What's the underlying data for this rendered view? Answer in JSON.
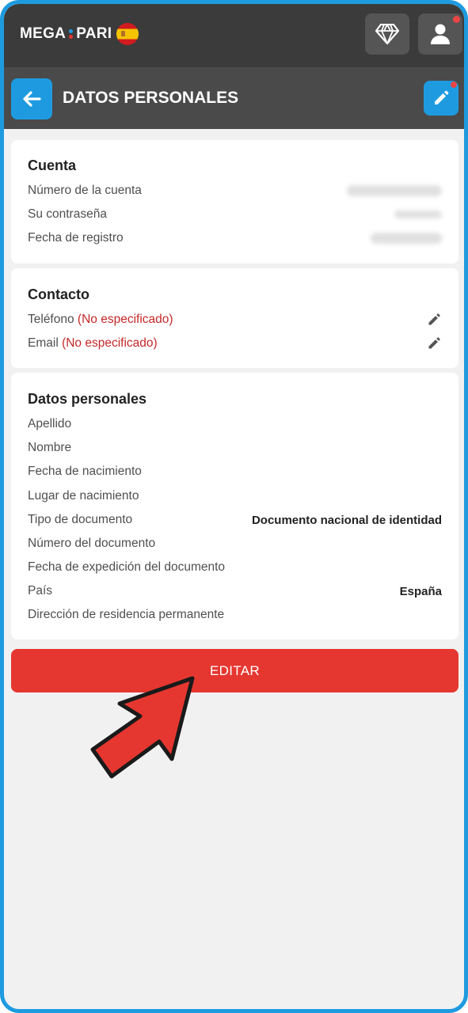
{
  "brand": {
    "left": "MEGA",
    "right": "PARI",
    "accent": "#1e9be0",
    "dot_top": "#1e9be0",
    "dot_bottom": "#e53730"
  },
  "header": {
    "title": "DATOS PERSONALES"
  },
  "account": {
    "title": "Cuenta",
    "rows": [
      {
        "label": "Número de la cuenta"
      },
      {
        "label": "Su contraseña"
      },
      {
        "label": "Fecha de registro"
      }
    ]
  },
  "contact": {
    "title": "Contacto",
    "rows": [
      {
        "label": "Teléfono",
        "status": "(No especificado)"
      },
      {
        "label": "Email",
        "status": "(No especificado)"
      }
    ]
  },
  "personal": {
    "title": "Datos personales",
    "rows": [
      {
        "label": "Apellido",
        "value": ""
      },
      {
        "label": "Nombre",
        "value": ""
      },
      {
        "label": "Fecha de nacimiento",
        "value": ""
      },
      {
        "label": "Lugar de nacimiento",
        "value": ""
      },
      {
        "label": "Tipo de documento",
        "value": "Documento nacional de identidad"
      },
      {
        "label": "Número del documento",
        "value": ""
      },
      {
        "label": "Fecha de expedición del documento",
        "value": ""
      },
      {
        "label": "País",
        "value": "España"
      },
      {
        "label": "Dirección de residencia permanente",
        "value": ""
      }
    ]
  },
  "actions": {
    "edit_label": "EDITAR"
  },
  "icons": [
    "diamond-icon",
    "user-icon",
    "back-arrow-icon",
    "pencil-icon",
    "flag-spain-icon"
  ],
  "colors": {
    "topbar": "#3b3b3b",
    "subheader": "#4a4a4a",
    "primary_button": "#e53730",
    "unspecified": "#c62828"
  }
}
